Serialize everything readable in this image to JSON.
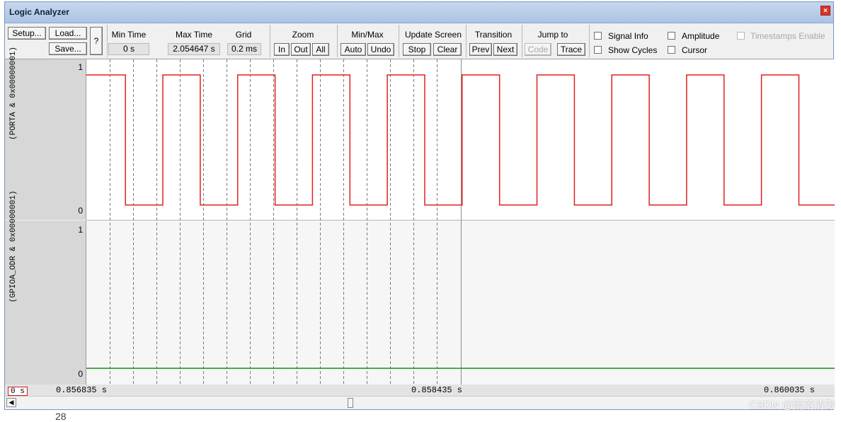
{
  "window": {
    "title": "Logic Analyzer"
  },
  "toolbar": {
    "setup": "Setup...",
    "load": "Load...",
    "save": "Save...",
    "help": "?",
    "min_time": {
      "label": "Min Time",
      "value": "0 s"
    },
    "max_time": {
      "label": "Max Time",
      "value": "2.054647 s"
    },
    "grid": {
      "label": "Grid",
      "value": "0.2 ms"
    },
    "zoom": {
      "label": "Zoom",
      "in": "In",
      "out": "Out",
      "all": "All"
    },
    "minmax": {
      "label": "Min/Max",
      "auto": "Auto",
      "undo": "Undo"
    },
    "update": {
      "label": "Update Screen",
      "stop": "Stop",
      "clear": "Clear"
    },
    "transition": {
      "label": "Transition",
      "prev": "Prev",
      "next": "Next"
    },
    "jump": {
      "label": "Jump to",
      "code": "Code",
      "trace": "Trace"
    },
    "options": {
      "signal_info": "Signal Info",
      "amplitude": "Amplitude",
      "timestamps": "Timestamps Enable",
      "show_cycles": "Show Cycles",
      "cursor": "Cursor"
    }
  },
  "signals": [
    {
      "name": "(PORTA & 0x00000001)",
      "high_label": "1",
      "low_label": "0",
      "color": "#e02020",
      "transitions": [
        0.856835,
        0.857002,
        0.857162,
        0.857322,
        0.857482,
        0.857642,
        0.857802,
        0.857962,
        0.858122,
        0.858282,
        0.858442,
        0.858602,
        0.858762,
        0.858922,
        0.859082,
        0.859242,
        0.859402,
        0.859562,
        0.859722,
        0.859882,
        0.860035
      ],
      "levels": [
        1,
        0,
        1,
        0,
        1,
        0,
        1,
        0,
        1,
        0,
        1
      ],
      "initial_level": 1
    },
    {
      "name": "(GPIOA_ODR & 0x00000001)",
      "high_label": "1",
      "low_label": "0",
      "color": "#1a8a1a",
      "constant_level": 0
    }
  ],
  "time_axis": {
    "start": 0.856835,
    "end": 0.860035,
    "grid_step_ms": 0.2,
    "labels": [
      "0.856835 s",
      "0.858435 s",
      "0.860035 s"
    ],
    "cursor_label": "0 s"
  },
  "overflow_text": "28",
  "watermark": "CSDN @雨落清渺"
}
